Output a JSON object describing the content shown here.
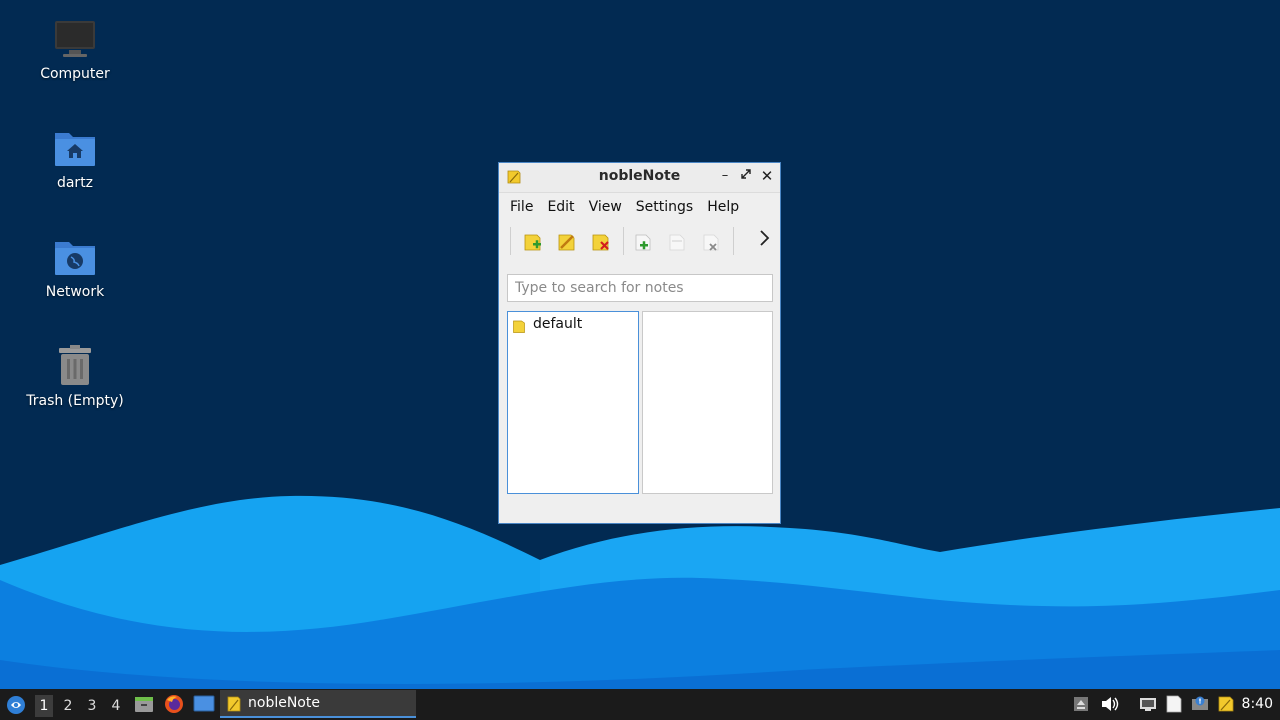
{
  "desktop": {
    "icons": [
      {
        "label": "Computer",
        "icon": "monitor-icon"
      },
      {
        "label": "dartz",
        "icon": "home-folder-icon"
      },
      {
        "label": "Network",
        "icon": "network-folder-icon"
      },
      {
        "label": "Trash (Empty)",
        "icon": "trash-icon"
      }
    ],
    "colors": {
      "background": "#022a52",
      "wave_light": "#1aa0f0",
      "wave_dark": "#0a78d8"
    }
  },
  "window": {
    "title": "nobleNote",
    "controls": [
      "minimize-icon",
      "maximize-icon",
      "close-icon"
    ],
    "menu": [
      "File",
      "Edit",
      "View",
      "Settings",
      "Help"
    ],
    "toolbar": {
      "buttons": [
        "new-folder-icon",
        "rename-folder-icon",
        "delete-folder-icon",
        "new-note-icon",
        "rename-note-icon",
        "delete-note-icon"
      ],
      "overflow_icon": "chevron-right-icon"
    },
    "search": {
      "placeholder": "Type to search for notes",
      "value": ""
    },
    "folders": [
      {
        "name": "default",
        "icon": "folder-icon"
      }
    ],
    "notes": []
  },
  "taskbar": {
    "start_icon": "start-menu-icon",
    "workspaces": [
      "1",
      "2",
      "3",
      "4"
    ],
    "active_workspace": "1",
    "launchers": [
      "file-manager-icon",
      "firefox-icon",
      "desktop-icon"
    ],
    "task": {
      "label": "nobleNote",
      "icon": "noblenote-icon"
    },
    "tray": [
      "eject-icon",
      "volume-icon",
      "network-icon",
      "clipboard-icon",
      "update-icon",
      "noblenote-tray-icon"
    ],
    "clock": "8:40"
  }
}
